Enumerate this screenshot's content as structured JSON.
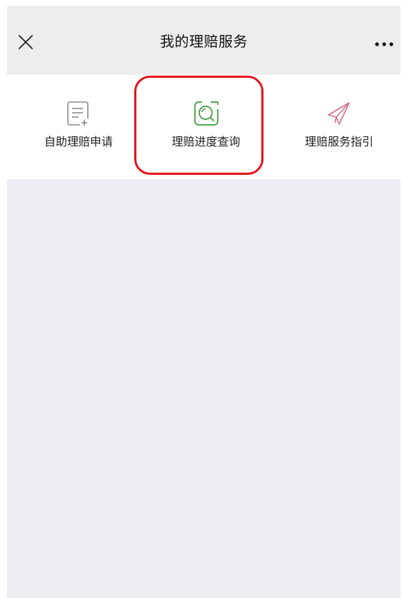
{
  "header": {
    "title": "我的理赔服务",
    "close_icon": "close-icon",
    "more_icon": "more-icon"
  },
  "menu": {
    "items": [
      {
        "label": "自助理赔申请",
        "icon": "document-add-icon",
        "color": "#8a8a8a"
      },
      {
        "label": "理赔进度查询",
        "icon": "search-square-icon",
        "color": "#3b9a3f"
      },
      {
        "label": "理赔服务指引",
        "icon": "paper-plane-icon",
        "color": "#d86e86"
      }
    ]
  },
  "colors": {
    "header_bg": "#ededed",
    "content_bg": "#efeef4",
    "highlight": "#e3141c"
  }
}
